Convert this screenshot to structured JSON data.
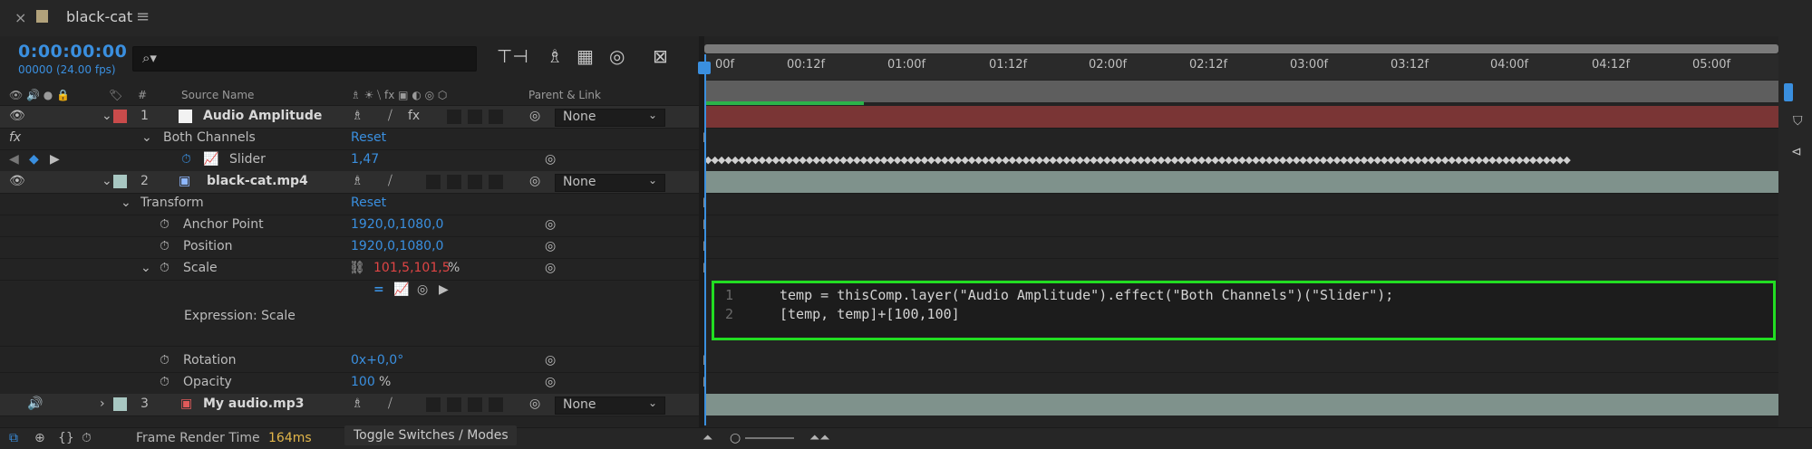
{
  "tab": {
    "title": "black-cat"
  },
  "header": {
    "timecode": "0:00:00:00",
    "fps": "00000 (24.00 fps)",
    "search_placeholder": ""
  },
  "columns": {
    "source_name": "Source Name",
    "parent_link": "Parent & Link",
    "number": "#"
  },
  "layers": [
    {
      "index": "1",
      "name": "Audio Amplitude",
      "label_color": "#c94b4b",
      "parent": "None"
    },
    {
      "index": "2",
      "name": "black-cat.mp4",
      "label_color": "#a8c7c2",
      "parent": "None"
    },
    {
      "index": "3",
      "name": "My audio.mp3",
      "label_color": "#a8c7c2",
      "parent": "None"
    }
  ],
  "properties": {
    "both_channels": "Both Channels",
    "both_channels_reset": "Reset",
    "slider": "Slider",
    "slider_value": "1,47",
    "transform": "Transform",
    "transform_reset": "Reset",
    "anchor_point": "Anchor Point",
    "anchor_point_value": "1920,0,1080,0",
    "position": "Position",
    "position_value": "1920,0,1080,0",
    "scale": "Scale",
    "scale_value": "101,5,101,5",
    "scale_unit": "%",
    "expression_label": "Expression: Scale",
    "rotation": "Rotation",
    "rotation_value": "0x+0,0°",
    "opacity": "Opacity",
    "opacity_value": "100",
    "opacity_unit": "%"
  },
  "ruler_ticks": [
    "00f",
    "00:12f",
    "01:00f",
    "01:12f",
    "02:00f",
    "02:12f",
    "03:00f",
    "03:12f",
    "04:00f",
    "04:12f",
    "05:00f"
  ],
  "expression": {
    "line1_num": "1",
    "line2_num": "2",
    "line1": "temp = thisComp.layer(\"Audio Amplitude\").effect(\"Both Channels\")(\"Slider\");",
    "line2": "[temp, temp]+[100,100]"
  },
  "footer": {
    "frame_render_label": "Frame Render Time",
    "frame_render_value": "164ms",
    "toggle_label": "Toggle Switches / Modes"
  },
  "colors": {
    "accent": "#3a8fdf",
    "layer1_bar": "#7a3535",
    "layer_bar_teal": "#7f928c",
    "expression_border": "#22dd22"
  }
}
